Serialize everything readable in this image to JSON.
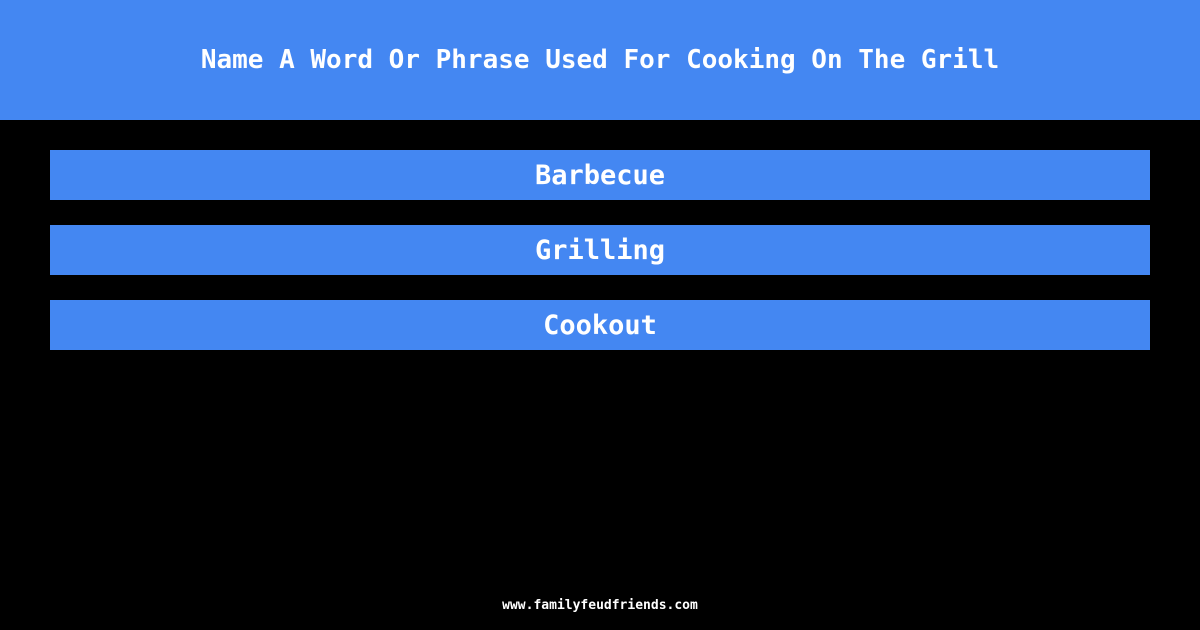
{
  "question": "Name A Word Or Phrase Used For Cooking On The Grill",
  "answers": [
    {
      "text": "Barbecue"
    },
    {
      "text": "Grilling"
    },
    {
      "text": "Cookout"
    }
  ],
  "footer": "www.familyfeudfriends.com",
  "colors": {
    "accent": "#4487f2",
    "background": "#000000",
    "text": "#ffffff"
  }
}
